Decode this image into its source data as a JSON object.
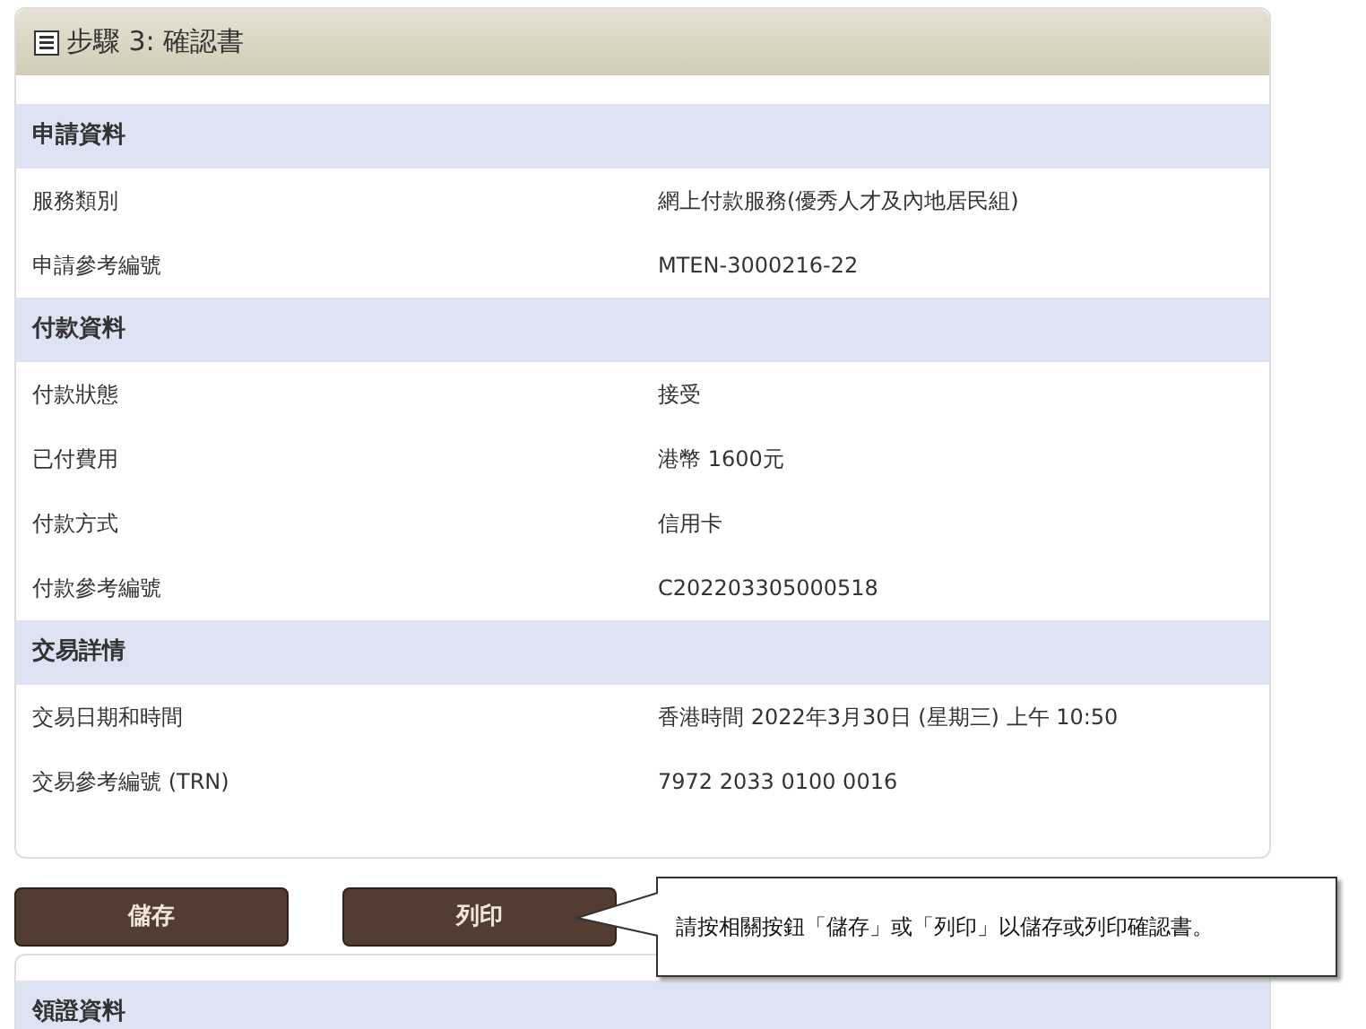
{
  "title": "步驟 3: 確認書",
  "sections": [
    {
      "heading": "申請資料",
      "rows": [
        {
          "label": "服務類別",
          "value": "網上付款服務(優秀人才及內地居民組)"
        },
        {
          "label": "申請參考編號",
          "value": "MTEN-3000216-22"
        }
      ]
    },
    {
      "heading": "付款資料",
      "rows": [
        {
          "label": "付款狀態",
          "value": "接受"
        },
        {
          "label": "已付費用",
          "value": "港幣 1600元"
        },
        {
          "label": "付款方式",
          "value": "信用卡"
        },
        {
          "label": "付款參考編號",
          "value": "C202203305000518"
        }
      ]
    },
    {
      "heading": "交易詳情",
      "rows": [
        {
          "label": "交易日期和時間",
          "value": "香港時間 2022年3月30日 (星期三) 上午 10:50"
        },
        {
          "label": "交易參考編號 (TRN)",
          "value": "7972 2033 0100 0016"
        }
      ]
    }
  ],
  "buttons": [
    "儲存",
    "列印"
  ],
  "callout": "請按相關按鈕「儲存」或「列印」以儲存或列印確認書。",
  "next_section": {
    "heading": "領證資料"
  }
}
